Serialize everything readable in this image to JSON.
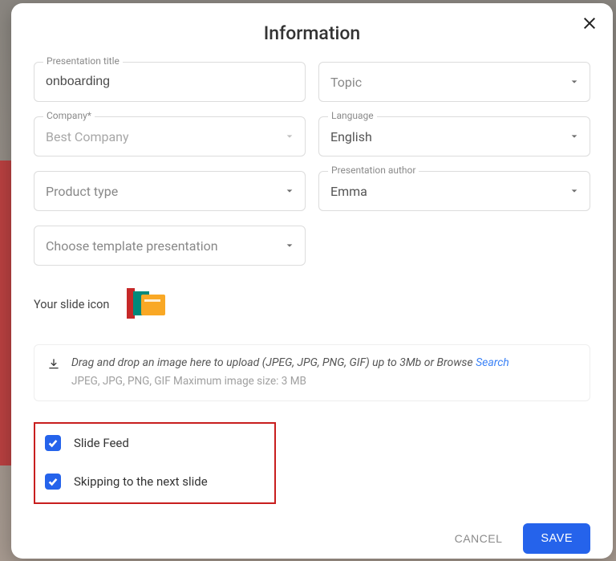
{
  "modal": {
    "title": "Information",
    "fields": {
      "presentation_title": {
        "label": "Presentation title",
        "value": "onboarding"
      },
      "company": {
        "label": "Company*",
        "value": "Best Company"
      },
      "product_type": {
        "label": "",
        "placeholder": "Product type"
      },
      "template": {
        "label": "",
        "placeholder": "Choose template presentation"
      },
      "topic": {
        "label": "",
        "placeholder": "Topic"
      },
      "language": {
        "label": "Language",
        "value": "English"
      },
      "author": {
        "label": "Presentation author",
        "value": "Emma"
      }
    },
    "slide_icon_label": "Your slide icon",
    "dropzone": {
      "main": "Drag and drop an image here to upload (JPEG, JPG, PNG, GIF) up to 3Mb or Browse ",
      "link": "Search",
      "sub": "JPEG, JPG, PNG, GIF  Maximum image size: 3 MB"
    },
    "checkboxes": {
      "slide_feed": {
        "label": "Slide Feed",
        "checked": true
      },
      "skipping": {
        "label": "Skipping to the next slide",
        "checked": true
      }
    },
    "buttons": {
      "cancel": "CANCEL",
      "save": "SAVE"
    }
  }
}
